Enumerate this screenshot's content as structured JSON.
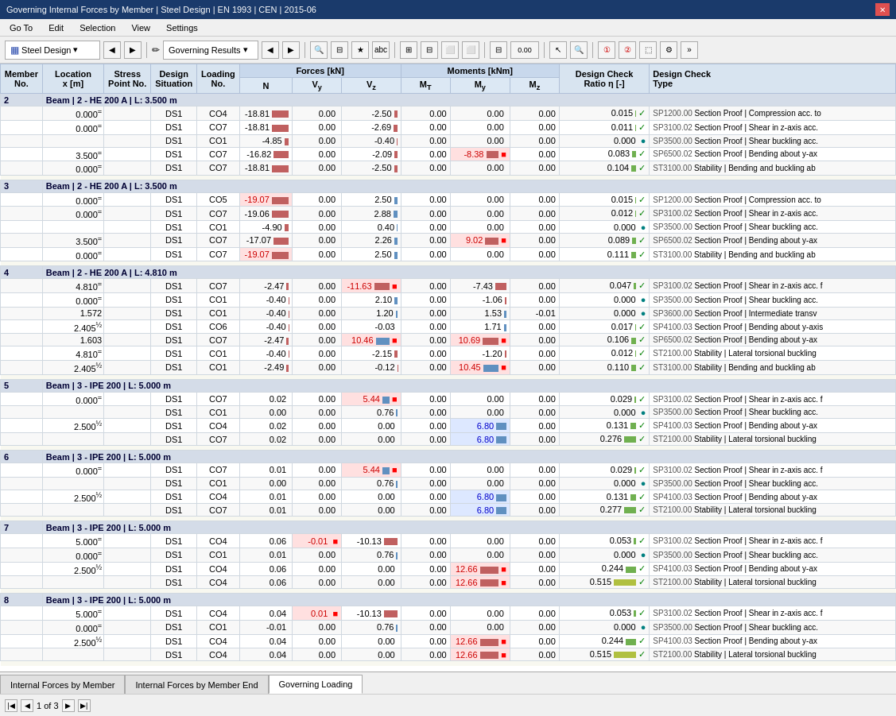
{
  "titleBar": {
    "title": "Governing Internal Forces by Member | Steel Design | EN 1993 | CEN | 2015-06"
  },
  "menuBar": {
    "items": [
      "Go To",
      "Edit",
      "Selection",
      "View",
      "Settings"
    ]
  },
  "toolbar": {
    "leftDropdown": "Steel Design",
    "rightDropdown": "Governing Results"
  },
  "columnHeaders": {
    "memberNo": "Member\nNo.",
    "locationX": "Location\nx [m]",
    "stressPoint": "Stress\nPoint No.",
    "designSituation": "Design\nSituation",
    "loadingNo": "Loading\nNo.",
    "forcesLabel": "Forces [kN]",
    "N": "N",
    "Vy": "Vy",
    "Vz": "Vz",
    "momentsLabel": "Moments [kNm]",
    "Mt": "MT",
    "My": "My",
    "Mz": "Mz",
    "dcRatio": "Design Check\nRatio η [-]",
    "dcType": "Design Check\nType"
  },
  "tabs": [
    {
      "label": "Internal Forces by Member",
      "active": false
    },
    {
      "label": "Internal Forces by Member End",
      "active": false
    },
    {
      "label": "Governing Loading",
      "active": true
    }
  ],
  "statusBar": {
    "pageInfo": "1 of 3"
  },
  "sections": [
    {
      "id": 2,
      "label": "Beam | 2 - HE 200 A | L: 3.500 m",
      "rows": [
        {
          "location": "0.000",
          "locationFlag": "=",
          "stressPoint": "",
          "situation": "DS1",
          "loading": "CO4",
          "N": "-18.81",
          "Vy": "0.00",
          "Vz": "-2.50",
          "Mt": "0.00",
          "My": "0.00",
          "Mz": "0.00",
          "dcr": "0.015",
          "dcrCheck": "✓",
          "spCode": "SP1200.00",
          "desc": "Section Proof | Compression acc. to"
        },
        {
          "location": "0.000",
          "locationFlag": "=",
          "stressPoint": "",
          "situation": "DS1",
          "loading": "CO7",
          "N": "-18.81",
          "Vy": "0.00",
          "Vz": "-2.69",
          "Mt": "0.00",
          "My": "0.00",
          "Mz": "0.00",
          "dcr": "0.011",
          "dcrCheck": "✓",
          "spCode": "SP3100.02",
          "desc": "Section Proof | Shear in z-axis acc."
        },
        {
          "location": "",
          "locationFlag": "",
          "stressPoint": "",
          "situation": "DS1",
          "loading": "CO1",
          "N": "-4.85",
          "Vy": "0.00",
          "Vz": "-0.40",
          "Mt": "0.00",
          "My": "0.00",
          "Mz": "0.00",
          "dcr": "0.000",
          "dcrCheck": "●",
          "spCode": "SP3500.00",
          "desc": "Section Proof | Shear buckling acc."
        },
        {
          "location": "3.500",
          "locationFlag": "=",
          "stressPoint": "",
          "situation": "DS1",
          "loading": "CO7",
          "N": "-16.82",
          "Vy": "0.00",
          "Vz": "-2.09",
          "Mt": "0.00",
          "My": "-8.38",
          "myFlag": "red",
          "Mz": "0.00",
          "dcr": "0.083",
          "dcrCheck": "✓",
          "spCode": "SP6500.02",
          "desc": "Section Proof | Bending about y-ax"
        },
        {
          "location": "0.000",
          "locationFlag": "=",
          "stressPoint": "",
          "situation": "DS1",
          "loading": "CO7",
          "N": "-18.81",
          "Vy": "0.00",
          "Vz": "-2.50",
          "Mt": "0.00",
          "My": "0.00",
          "Mz": "0.00",
          "dcr": "0.104",
          "dcrCheck": "✓",
          "spCode": "ST3100.00",
          "desc": "Stability | Bending and buckling ab"
        }
      ]
    },
    {
      "id": 3,
      "label": "Beam | 2 - HE 200 A | L: 3.500 m",
      "rows": [
        {
          "location": "0.000",
          "locationFlag": "=",
          "stressPoint": "",
          "situation": "DS1",
          "loading": "CO5",
          "N": "-19.07",
          "nFlag": "red",
          "Vy": "0.00",
          "Vz": "2.50",
          "Mt": "0.00",
          "My": "0.00",
          "Mz": "0.00",
          "dcr": "0.015",
          "dcrCheck": "✓",
          "spCode": "SP1200.00",
          "desc": "Section Proof | Compression acc. to"
        },
        {
          "location": "0.000",
          "locationFlag": "=",
          "stressPoint": "",
          "situation": "DS1",
          "loading": "CO7",
          "N": "-19.06",
          "Vy": "0.00",
          "Vz": "2.88",
          "Mt": "0.00",
          "My": "0.00",
          "Mz": "0.00",
          "dcr": "0.012",
          "dcrCheck": "✓",
          "spCode": "SP3100.02",
          "desc": "Section Proof | Shear in z-axis acc."
        },
        {
          "location": "",
          "locationFlag": "",
          "stressPoint": "",
          "situation": "DS1",
          "loading": "CO1",
          "N": "-4.90",
          "Vy": "0.00",
          "Vz": "0.40",
          "Mt": "0.00",
          "My": "0.00",
          "Mz": "0.00",
          "dcr": "0.000",
          "dcrCheck": "●",
          "spCode": "SP3500.00",
          "desc": "Section Proof | Shear buckling acc."
        },
        {
          "location": "3.500",
          "locationFlag": "=",
          "stressPoint": "",
          "situation": "DS1",
          "loading": "CO7",
          "N": "-17.07",
          "Vy": "0.00",
          "Vz": "2.26",
          "Mt": "0.00",
          "My": "9.02",
          "myFlag": "red",
          "Mz": "0.00",
          "dcr": "0.089",
          "dcrCheck": "✓",
          "spCode": "SP6500.02",
          "desc": "Section Proof | Bending about y-ax"
        },
        {
          "location": "0.000",
          "locationFlag": "=",
          "stressPoint": "",
          "situation": "DS1",
          "loading": "CO7",
          "N": "-19.07",
          "nFlag": "red",
          "Vy": "0.00",
          "Vz": "2.50",
          "Mt": "0.00",
          "My": "0.00",
          "Mz": "0.00",
          "dcr": "0.111",
          "dcrCheck": "✓",
          "spCode": "ST3100.00",
          "desc": "Stability | Bending and buckling ab"
        }
      ]
    },
    {
      "id": 4,
      "label": "Beam | 2 - HE 200 A | L: 4.810 m",
      "rows": [
        {
          "location": "4.810",
          "locationFlag": "=",
          "stressPoint": "",
          "situation": "DS1",
          "loading": "CO7",
          "N": "-2.47",
          "Vy": "0.00",
          "vzFlag": "red",
          "Vz": "-11.63",
          "Mt": "0.00",
          "My": "-7.43",
          "Mz": "0.00",
          "dcr": "0.047",
          "dcrCheck": "✓",
          "spCode": "SP3100.02",
          "desc": "Section Proof | Shear in z-axis acc. f"
        },
        {
          "location": "0.000",
          "locationFlag": "=",
          "stressPoint": "",
          "situation": "DS1",
          "loading": "CO1",
          "N": "-0.40",
          "Vy": "0.00",
          "Vz": "2.10",
          "Mt": "0.00",
          "My": "-1.06",
          "Mz": "0.00",
          "dcr": "0.000",
          "dcrCheck": "●",
          "spCode": "SP3500.00",
          "desc": "Section Proof | Shear buckling acc."
        },
        {
          "location": "1.572",
          "locationFlag": "",
          "stressPoint": "",
          "situation": "DS1",
          "loading": "CO1",
          "N": "-0.40",
          "Vy": "0.00",
          "Vz": "1.20",
          "Mt": "0.00",
          "My": "1.53",
          "Mz": "-0.01",
          "dcr": "0.000",
          "dcrCheck": "●",
          "spCode": "SP3600.00",
          "desc": "Section Proof | Intermediate transv"
        },
        {
          "location": "2.405",
          "locationFlag": "½",
          "stressPoint": "",
          "situation": "DS1",
          "loading": "CO6",
          "N": "-0.40",
          "Vy": "0.00",
          "Vz": "-0.03",
          "Mt": "0.00",
          "My": "1.71",
          "Mz": "0.00",
          "dcr": "0.017",
          "dcrCheck": "✓",
          "spCode": "SP4100.03",
          "desc": "Section Proof | Bending about y-axis"
        },
        {
          "location": "1.603",
          "locationFlag": "",
          "stressPoint": "",
          "situation": "DS1",
          "loading": "CO7",
          "N": "-2.47",
          "Vy": "0.00",
          "vzFlag2": "red",
          "Vz": "10.46",
          "Mt": "0.00",
          "My": "10.69",
          "myFlag": "red",
          "Mz": "0.00",
          "dcr": "0.106",
          "dcrCheck": "✓",
          "spCode": "SP6500.02",
          "desc": "Section Proof | Bending about y-ax"
        },
        {
          "location": "4.810",
          "locationFlag": "=",
          "stressPoint": "",
          "situation": "DS1",
          "loading": "CO1",
          "N": "-0.40",
          "Vy": "0.00",
          "Vz": "-2.15",
          "Mt": "0.00",
          "My": "-1.20",
          "Mz": "0.00",
          "dcr": "0.012",
          "dcrCheck": "✓",
          "spCode": "ST2100.00",
          "desc": "Stability | Lateral torsional buckling"
        },
        {
          "location": "2.405",
          "locationFlag": "½",
          "stressPoint": "",
          "situation": "DS1",
          "loading": "CO1",
          "N": "-2.49",
          "Vy": "0.00",
          "Vz": "-0.12",
          "Mt": "0.00",
          "My": "10.45",
          "myFlag2": "red",
          "Mz": "0.00",
          "dcr": "0.110",
          "dcrCheck": "✓",
          "spCode": "ST3100.00",
          "desc": "Stability | Bending and buckling ab"
        }
      ]
    },
    {
      "id": 5,
      "label": "Beam | 3 - IPE 200 | L: 5.000 m",
      "rows": [
        {
          "location": "0.000",
          "locationFlag": "=",
          "stressPoint": "",
          "situation": "DS1",
          "loading": "CO7",
          "N": "0.02",
          "Vy": "0.00",
          "vzFlag": "red",
          "Vz": "5.44",
          "Mt": "0.00",
          "My": "0.00",
          "Mz": "0.00",
          "dcr": "0.029",
          "dcrCheck": "✓",
          "spCode": "SP3100.02",
          "desc": "Section Proof | Shear in z-axis acc. f"
        },
        {
          "location": "",
          "locationFlag": "",
          "stressPoint": "",
          "situation": "DS1",
          "loading": "CO1",
          "N": "0.00",
          "Vy": "0.00",
          "Vz": "0.76",
          "Mt": "0.00",
          "My": "0.00",
          "Mz": "0.00",
          "dcr": "0.000",
          "dcrCheck": "●",
          "spCode": "SP3500.00",
          "desc": "Section Proof | Shear buckling acc."
        },
        {
          "location": "2.500",
          "locationFlag": "½",
          "stressPoint": "",
          "situation": "DS1",
          "loading": "CO4",
          "N": "0.02",
          "Vy": "0.00",
          "Vz": "0.00",
          "Mt": "0.00",
          "My": "6.80",
          "myFlag": "blue",
          "Mz": "0.00",
          "dcr": "0.131",
          "dcrCheck": "✓",
          "spCode": "SP4100.03",
          "desc": "Section Proof | Bending about y-ax"
        },
        {
          "location": "",
          "locationFlag": "",
          "stressPoint": "",
          "situation": "DS1",
          "loading": "CO7",
          "N": "0.02",
          "Vy": "0.00",
          "Vz": "0.00",
          "Mt": "0.00",
          "My": "6.80",
          "myFlag": "blue",
          "Mz": "0.00",
          "dcr": "0.276",
          "dcrCheck": "✓",
          "spCode": "ST2100.00",
          "desc": "Stability | Lateral torsional buckling"
        }
      ]
    },
    {
      "id": 6,
      "label": "Beam | 3 - IPE 200 | L: 5.000 m",
      "rows": [
        {
          "location": "0.000",
          "locationFlag": "=",
          "stressPoint": "",
          "situation": "DS1",
          "loading": "CO7",
          "N": "0.01",
          "Vy": "0.00",
          "vzFlag": "red",
          "Vz": "5.44",
          "Mt": "0.00",
          "My": "0.00",
          "Mz": "0.00",
          "dcr": "0.029",
          "dcrCheck": "✓",
          "spCode": "SP3100.02",
          "desc": "Section Proof | Shear in z-axis acc. f"
        },
        {
          "location": "",
          "locationFlag": "",
          "stressPoint": "",
          "situation": "DS1",
          "loading": "CO1",
          "N": "0.00",
          "Vy": "0.00",
          "Vz": "0.76",
          "Mt": "0.00",
          "My": "0.00",
          "Mz": "0.00",
          "dcr": "0.000",
          "dcrCheck": "●",
          "spCode": "SP3500.00",
          "desc": "Section Proof | Shear buckling acc."
        },
        {
          "location": "2.500",
          "locationFlag": "½",
          "stressPoint": "",
          "situation": "DS1",
          "loading": "CO4",
          "N": "0.01",
          "Vy": "0.00",
          "Vz": "0.00",
          "Mt": "0.00",
          "My": "6.80",
          "myFlag": "blue",
          "Mz": "0.00",
          "dcr": "0.131",
          "dcrCheck": "✓",
          "spCode": "SP4100.03",
          "desc": "Section Proof | Bending about y-ax"
        },
        {
          "location": "",
          "locationFlag": "",
          "stressPoint": "",
          "situation": "DS1",
          "loading": "CO7",
          "N": "0.01",
          "Vy": "0.00",
          "Vz": "0.00",
          "Mt": "0.00",
          "My": "6.80",
          "myFlag": "blue",
          "Mz": "0.00",
          "dcr": "0.277",
          "dcrCheck": "✓",
          "spCode": "ST2100.00",
          "desc": "Stability | Lateral torsional buckling"
        }
      ]
    },
    {
      "id": 7,
      "label": "Beam | 3 - IPE 200 | L: 5.000 m",
      "rows": [
        {
          "location": "5.000",
          "locationFlag": "=",
          "stressPoint": "",
          "situation": "DS1",
          "loading": "CO4",
          "N": "0.06",
          "Vy": "-0.01",
          "vyFlag": "red",
          "Vz": "-10.13",
          "Mt": "0.00",
          "My": "0.00",
          "Mz": "0.00",
          "dcr": "0.053",
          "dcrCheck": "✓",
          "spCode": "SP3100.02",
          "desc": "Section Proof | Shear in z-axis acc. f"
        },
        {
          "location": "0.000",
          "locationFlag": "=",
          "stressPoint": "",
          "situation": "DS1",
          "loading": "CO1",
          "N": "0.01",
          "Vy": "0.00",
          "Vz": "0.76",
          "Mt": "0.00",
          "My": "0.00",
          "Mz": "0.00",
          "dcr": "0.000",
          "dcrCheck": "●",
          "spCode": "SP3500.00",
          "desc": "Section Proof | Shear buckling acc."
        },
        {
          "location": "2.500",
          "locationFlag": "½",
          "stressPoint": "",
          "situation": "DS1",
          "loading": "CO4",
          "N": "0.06",
          "Vy": "0.00",
          "Vz": "0.00",
          "Mt": "0.00",
          "My": "12.66",
          "myFlag": "red",
          "Mz": "0.00",
          "dcr": "0.244",
          "dcrCheck": "✓",
          "spCode": "SP4100.03",
          "desc": "Section Proof | Bending about y-ax"
        },
        {
          "location": "",
          "locationFlag": "",
          "stressPoint": "",
          "situation": "DS1",
          "loading": "CO4",
          "N": "0.06",
          "Vy": "0.00",
          "Vz": "0.00",
          "Mt": "0.00",
          "My": "12.66",
          "myFlag": "red",
          "Mz": "0.00",
          "dcr": "0.515",
          "dcrCheck": "✓",
          "spCode": "ST2100.00",
          "desc": "Stability | Lateral torsional buckling"
        }
      ]
    },
    {
      "id": 8,
      "label": "Beam | 3 - IPE 200 | L: 5.000 m",
      "rows": [
        {
          "location": "5.000",
          "locationFlag": "=",
          "stressPoint": "",
          "situation": "DS1",
          "loading": "CO4",
          "N": "0.04",
          "Vy": "0.01",
          "vyFlag": "red",
          "Vz": "-10.13",
          "Mt": "0.00",
          "My": "0.00",
          "Mz": "0.00",
          "dcr": "0.053",
          "dcrCheck": "✓",
          "spCode": "SP3100.02",
          "desc": "Section Proof | Shear in z-axis acc. f"
        },
        {
          "location": "0.000",
          "locationFlag": "=",
          "stressPoint": "",
          "situation": "DS1",
          "loading": "CO1",
          "N": "-0.01",
          "Vy": "0.00",
          "Vz": "0.76",
          "Mt": "0.00",
          "My": "0.00",
          "Mz": "0.00",
          "dcr": "0.000",
          "dcrCheck": "●",
          "spCode": "SP3500.00",
          "desc": "Section Proof | Shear buckling acc."
        },
        {
          "location": "2.500",
          "locationFlag": "½",
          "stressPoint": "",
          "situation": "DS1",
          "loading": "CO4",
          "N": "0.04",
          "Vy": "0.00",
          "Vz": "0.00",
          "Mt": "0.00",
          "My": "12.66",
          "myFlag": "red",
          "Mz": "0.00",
          "dcr": "0.244",
          "dcrCheck": "✓",
          "spCode": "SP4100.03",
          "desc": "Section Proof | Bending about y-ax"
        },
        {
          "location": "",
          "locationFlag": "",
          "stressPoint": "",
          "situation": "DS1",
          "loading": "CO4",
          "N": "0.04",
          "Vy": "0.00",
          "Vz": "0.00",
          "Mt": "0.00",
          "My": "12.66",
          "myFlag": "red",
          "Mz": "0.00",
          "dcr": "0.515",
          "dcrCheck": "✓",
          "spCode": "ST2100.00",
          "desc": "Stability | Lateral torsional buckling"
        }
      ]
    }
  ]
}
